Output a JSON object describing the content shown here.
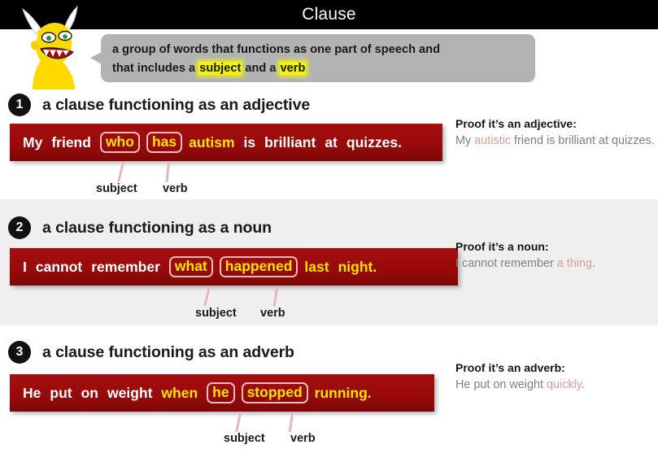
{
  "header": {
    "title": "Clause"
  },
  "colors": {
    "header_bg": "#000000",
    "bar_red": "#9a0a0a",
    "highlight_yellow": "#ffe400",
    "glow_yellow": "#f2f20f",
    "box_border_pink": "#f4bdbd",
    "proof_gray": "#808080",
    "proof_accent": "#e09a9a",
    "shaded_band": "#efeff0",
    "bubble_gray": "#b3b3b3"
  },
  "mascot": {
    "icon": "yellow-monster-icon"
  },
  "definition": {
    "line1": "a group of words that functions as one part of speech and",
    "line2_pre": "that includes a ",
    "line2_hl1": "subject",
    "line2_mid": " and a ",
    "line2_hl2": "verb"
  },
  "labels": {
    "subject": "subject",
    "verb": "verb"
  },
  "sections": [
    {
      "number": "1",
      "title": "a clause functioning as an adjective",
      "sentence": [
        {
          "text": "My",
          "style": "white"
        },
        {
          "text": "friend",
          "style": "white"
        },
        {
          "text": "who",
          "style": "boxed"
        },
        {
          "text": "has",
          "style": "boxed"
        },
        {
          "text": "autism",
          "style": "yellow"
        },
        {
          "text": "is",
          "style": "white"
        },
        {
          "text": "brilliant",
          "style": "white"
        },
        {
          "text": "at",
          "style": "white"
        },
        {
          "text": "quizzes.",
          "style": "white"
        }
      ],
      "proof_head": "Proof it’s an adjective:",
      "proof_parts": [
        {
          "text": "My ",
          "accent": false
        },
        {
          "text": "autistic",
          "accent": true
        },
        {
          "text": " friend is brilliant at quizzes.",
          "accent": false
        }
      ]
    },
    {
      "number": "2",
      "title": "a clause functioning as a noun",
      "sentence": [
        {
          "text": "I",
          "style": "white"
        },
        {
          "text": "cannot",
          "style": "white"
        },
        {
          "text": "remember",
          "style": "white"
        },
        {
          "text": "what",
          "style": "boxed"
        },
        {
          "text": "happened",
          "style": "boxed"
        },
        {
          "text": "last",
          "style": "yellow"
        },
        {
          "text": "night.",
          "style": "yellow"
        }
      ],
      "proof_head": "Proof it’s a noun:",
      "proof_parts": [
        {
          "text": "I cannot remember ",
          "accent": false
        },
        {
          "text": "a thing",
          "accent": true
        },
        {
          "text": ".",
          "accent": false
        }
      ]
    },
    {
      "number": "3",
      "title": "a clause functioning as an adverb",
      "sentence": [
        {
          "text": "He",
          "style": "white"
        },
        {
          "text": "put",
          "style": "white"
        },
        {
          "text": "on",
          "style": "white"
        },
        {
          "text": "weight",
          "style": "white"
        },
        {
          "text": "when",
          "style": "yellow"
        },
        {
          "text": "he",
          "style": "boxed"
        },
        {
          "text": "stopped",
          "style": "boxed"
        },
        {
          "text": "running.",
          "style": "yellow"
        }
      ],
      "proof_head": "Proof it’s an adverb:",
      "proof_parts": [
        {
          "text": "He put on weight ",
          "accent": false
        },
        {
          "text": "quickly",
          "accent": true
        },
        {
          "text": ".",
          "accent": false
        }
      ]
    }
  ]
}
